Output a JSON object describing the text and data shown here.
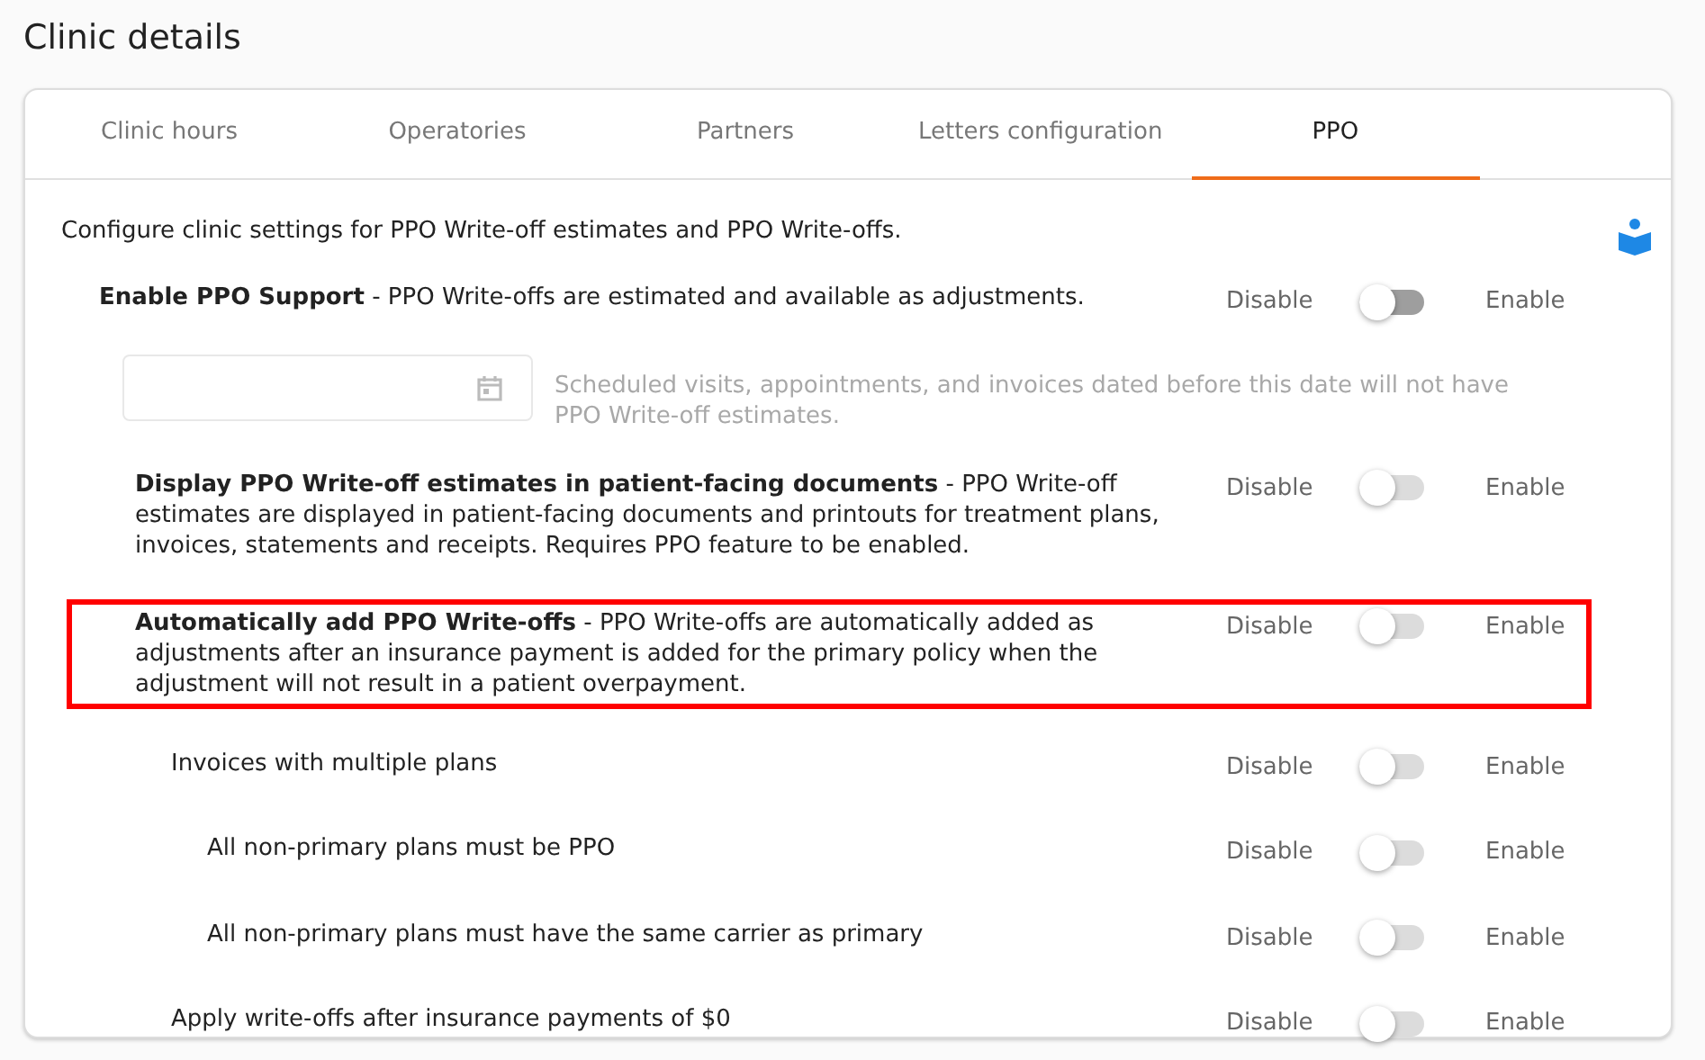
{
  "page_title": "Clinic details",
  "tabs": [
    {
      "label": "Clinic hours",
      "selected": false
    },
    {
      "label": "Operatories",
      "selected": false
    },
    {
      "label": "Partners",
      "selected": false
    },
    {
      "label": "Letters configuration",
      "selected": false
    },
    {
      "label": "PPO",
      "selected": true
    }
  ],
  "intro": "Configure clinic settings for PPO Write-off estimates and PPO Write-offs.",
  "settings": [
    {
      "title": "Enable PPO Support",
      "description": "- PPO Write-offs are estimated and available as adjustments.",
      "off_label": "Disable",
      "on_label": "Enable",
      "on": false,
      "disabled": false,
      "highlighted": false,
      "date_field": {
        "disabled": true,
        "note": "Scheduled visits, appointments, and invoices dated before this date will not have PPO Write-off estimates."
      },
      "children": [
        {
          "title": "Display PPO Write-off estimates in patient-facing documents",
          "description": "- PPO Write-off estimates are displayed in patient-facing documents and printouts for treatment plans, invoices, statements and receipts. Requires PPO feature to be enabled.",
          "off_label": "Disable",
          "on_label": "Enable",
          "on": false,
          "disabled": true,
          "highlighted": false
        },
        {
          "title": "Automatically add PPO Write-offs",
          "description": "- PPO Write-offs are automatically added as adjustments after an insurance payment is added for the primary policy when the adjustment will not result in a patient overpayment.",
          "off_label": "Disable",
          "on_label": "Enable",
          "on": false,
          "disabled": true,
          "highlighted": true,
          "children": [
            {
              "title": "Invoices with multiple plans",
              "off_label": "Disable",
              "on_label": "Enable",
              "on": false,
              "disabled": true,
              "highlighted": false,
              "children": [
                {
                  "title": "All non-primary plans must be PPO",
                  "off_label": "Disable",
                  "on_label": "Enable",
                  "on": false,
                  "disabled": true,
                  "highlighted": false
                },
                {
                  "title": "All non-primary plans must have the same carrier as primary",
                  "off_label": "Disable",
                  "on_label": "Enable",
                  "on": false,
                  "disabled": true,
                  "highlighted": false
                }
              ]
            },
            {
              "title": "Apply write-offs after insurance payments of $0",
              "off_label": "Disable",
              "on_label": "Enable",
              "on": false,
              "disabled": true,
              "highlighted": false
            }
          ]
        }
      ]
    }
  ]
}
